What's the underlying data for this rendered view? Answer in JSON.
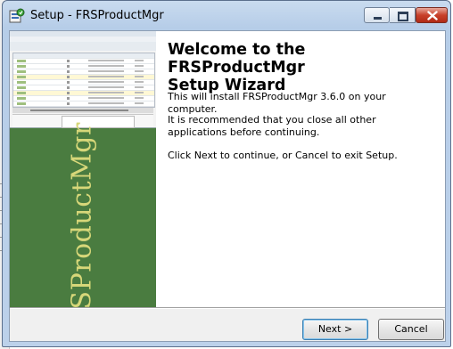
{
  "window": {
    "title": "Setup - FRSProductMgr"
  },
  "image_panel": {
    "brand_text": "FRSProductMgr"
  },
  "content": {
    "heading_line1": "Welcome to the FRSProductMgr",
    "heading_line2": "Setup Wizard",
    "para1": "This will install FRSProductMgr 3.6.0 on your computer.",
    "para2": "It is recommended that you close all other applications before continuing.",
    "para3": "Click Next to continue, or Cancel to exit Setup."
  },
  "buttons": {
    "next": "Next >",
    "cancel": "Cancel"
  },
  "colors": {
    "image_background": "#4a7c40",
    "brand_text": "#d7d779",
    "close_button": "#c8402a"
  }
}
